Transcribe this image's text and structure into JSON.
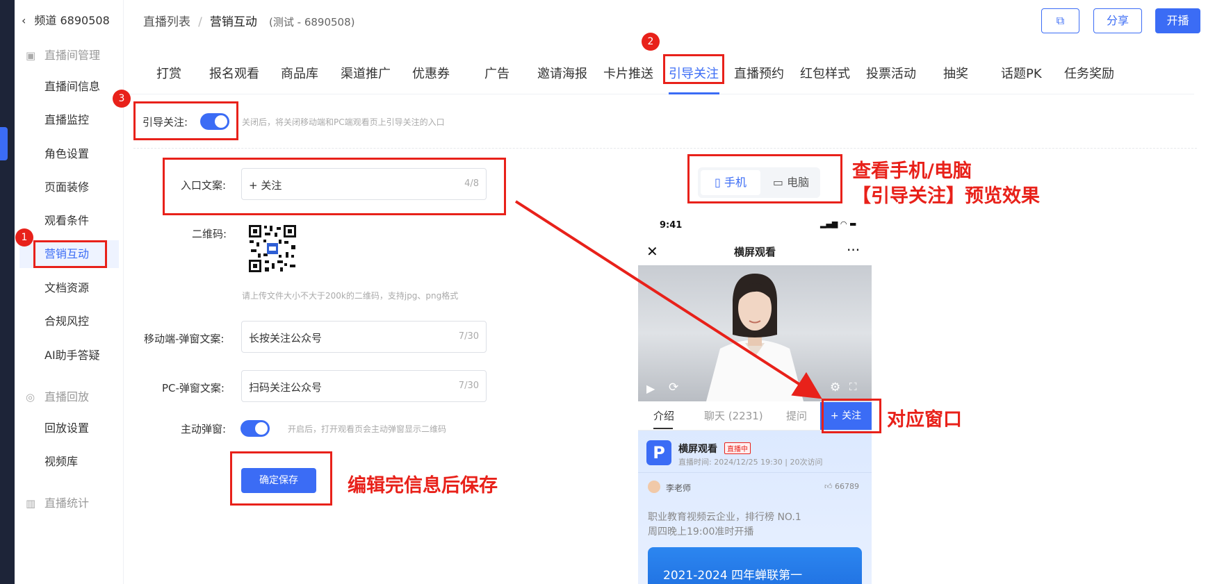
{
  "sidebar": {
    "back_label": "频道 6890508",
    "groups": [
      {
        "label": "直播间管理",
        "items": [
          "直播间信息",
          "直播监控",
          "角色设置",
          "页面装修",
          "观看条件",
          "营销互动",
          "文档资源",
          "合规风控",
          "AI助手答疑"
        ]
      },
      {
        "label": "直播回放",
        "items": [
          "回放设置",
          "视频库"
        ]
      },
      {
        "label": "直播统计",
        "items": []
      }
    ]
  },
  "header": {
    "crumb_parent": "直播列表",
    "crumb_sep": "/",
    "crumb_current": "营销互动",
    "crumb_sub": "(测试 - 6890508)",
    "share_label": "分享",
    "start_label": "开播"
  },
  "tabs": [
    "打赏",
    "报名观看",
    "商品库",
    "渠道推广",
    "优惠券",
    "广告",
    "邀请海报",
    "卡片推送",
    "引导关注",
    "直播预约",
    "红包样式",
    "投票活动",
    "抽奖",
    "话题PK",
    "任务奖励"
  ],
  "badges": {
    "one": "1",
    "two": "2",
    "three": "3"
  },
  "form": {
    "toggle_label": "引导关注:",
    "toggle_hint": "关闭后，将关闭移动端和PC端观看页上引导关注的入口",
    "entry_label": "入口文案:",
    "entry_value": "+ 关注",
    "entry_count": "4/8",
    "qr_label": "二维码:",
    "qr_hint": "请上传文件大小不大于200k的二维码，支持jpg、png格式",
    "mobile_label": "移动端-弹窗文案:",
    "mobile_value": "长按关注公众号",
    "mobile_count": "7/30",
    "pc_label": "PC-弹窗文案:",
    "pc_value": "扫码关注公众号",
    "pc_count": "7/30",
    "popup_label": "主动弹窗:",
    "popup_hint": "开启后，打开观看页会主动弹窗显示二维码",
    "save_label": "确定保存"
  },
  "preview": {
    "mobile_tab": "手机",
    "pc_tab": "电脑",
    "time": "9:41",
    "title": "横屏观看",
    "nav_intro": "介绍",
    "nav_chat": "聊天 (2231)",
    "nav_ask": "提问",
    "follow_label": "+ 关注",
    "channel_name": "横屏观看",
    "live_tag": "直播中",
    "meta": "直播时间: 2024/12/25 19:30  |  20次访问",
    "host": "李老师",
    "likes": "66789",
    "desc1": "职业教育视频云企业，排行榜 NO.1",
    "desc2": "周四晚上19:00准时开播",
    "banner": "2021-2024 四年蝉联第一"
  },
  "annotations": {
    "preview_note_1": "查看手机/电脑",
    "preview_note_2": "【引导关注】预览效果",
    "window_note": "对应窗口",
    "save_note": "编辑完信息后保存"
  },
  "colors": {
    "accent": "#3b6cf5",
    "annotation": "#e8211a",
    "sidebar_dark": "#1d2438"
  }
}
